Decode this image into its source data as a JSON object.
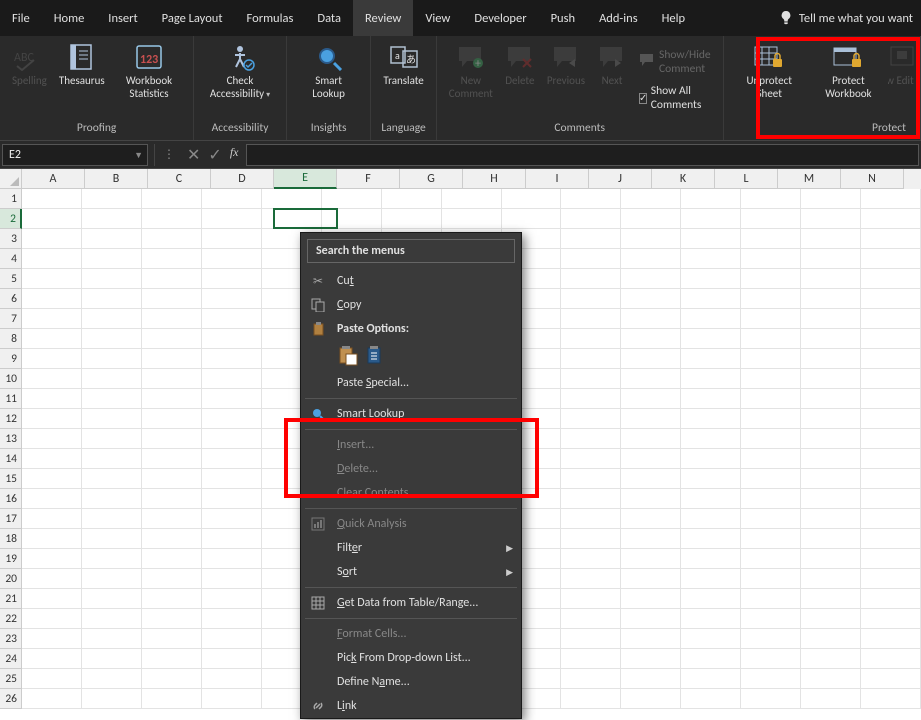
{
  "menubar": {
    "tabs": [
      "File",
      "Home",
      "Insert",
      "Page Layout",
      "Formulas",
      "Data",
      "Review",
      "View",
      "Developer",
      "Push",
      "Add-ins",
      "Help"
    ],
    "active_index": 6,
    "tell_me": "Tell me what you want"
  },
  "ribbon": {
    "groups": {
      "proofing": {
        "label": "Proofing",
        "spelling": "Spelling",
        "thesaurus": "Thesaurus",
        "workbook_stats": "Workbook Statistics"
      },
      "accessibility": {
        "label": "Accessibility",
        "check_accessibility": "Check Accessibility"
      },
      "insights": {
        "label": "Insights",
        "smart_lookup": "Smart Lookup"
      },
      "language": {
        "label": "Language",
        "translate": "Translate"
      },
      "comments": {
        "label": "Comments",
        "new_comment": "New Comment",
        "delete": "Delete",
        "previous": "Previous",
        "next": "Next",
        "show_hide": "Show/Hide Comment",
        "show_all": "Show All Comments"
      },
      "protect": {
        "label": "Protect",
        "unprotect_sheet": "Unprotect Sheet",
        "protect_workbook": "Protect Workbook",
        "allow_ranges": "Allow Edit Ranges"
      }
    }
  },
  "formula_bar": {
    "name_box": "E2"
  },
  "sheet": {
    "columns": [
      "A",
      "B",
      "C",
      "D",
      "E",
      "F",
      "G",
      "H",
      "I",
      "J",
      "K",
      "L",
      "M",
      "N"
    ],
    "rows": 26,
    "active_cell": "E2",
    "active_col_index": 4,
    "active_row_index": 1
  },
  "context_menu": {
    "search_placeholder": "Search the menus",
    "cut": "Cut",
    "copy": "Copy",
    "paste_options": "Paste Options:",
    "paste_special": "Paste Special...",
    "smart_lookup": "Smart Lookup",
    "insert": "Insert...",
    "delete": "Delete...",
    "clear_contents": "Clear Contents",
    "quick_analysis": "Quick Analysis",
    "filter": "Filter",
    "sort": "Sort",
    "get_data": "Get Data from Table/Range...",
    "format_cells": "Format Cells...",
    "pick_dropdown": "Pick From Drop-down List...",
    "define_name": "Define Name...",
    "link": "Link"
  }
}
